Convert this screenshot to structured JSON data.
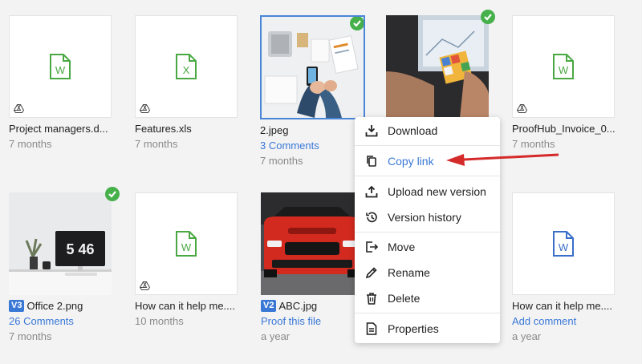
{
  "colors": {
    "word_green": "#4aa843",
    "word_blue": "#3a6fc9",
    "link_blue": "#3a78d6",
    "check_green": "#46b04a",
    "arrow_red": "#d42a2a"
  },
  "files": [
    {
      "name": "Project managers.d...",
      "line2": "7 months",
      "icon": "word-doc-icon"
    },
    {
      "name": "Features.xls",
      "line2": "7 months",
      "icon": "excel-doc-icon"
    },
    {
      "name": "2.jpeg",
      "line2": "3 Comments",
      "line3": "7 months",
      "checked": true
    },
    {
      "name": "",
      "checked": true
    },
    {
      "name": "ProofHub_Invoice_0...",
      "line2": "7 months",
      "icon": "word-doc-icon"
    },
    {
      "name": "Office 2.png",
      "version": "V3",
      "line2": "26 Comments",
      "line3": "7 months",
      "checked": true
    },
    {
      "name": "How can it help me....",
      "line2": "10 months",
      "icon": "word-doc-icon"
    },
    {
      "name": "ABC.jpg",
      "version": "V2",
      "line2": "Proof this file",
      "line3": "a year"
    },
    {
      "name": "How can it help me....",
      "line2": "Add comment",
      "line3": "a year",
      "icon": "word-doc-blue-icon"
    }
  ],
  "context_menu": {
    "items": [
      {
        "label": "Download",
        "icon": "download-icon"
      },
      {
        "label": "Copy link",
        "icon": "copy-icon",
        "active": true
      },
      {
        "label": "Upload new version",
        "icon": "upload-icon"
      },
      {
        "label": "Version history",
        "icon": "history-icon"
      },
      {
        "label": "Move",
        "icon": "move-icon"
      },
      {
        "label": "Rename",
        "icon": "pencil-icon"
      },
      {
        "label": "Delete",
        "icon": "trash-icon"
      },
      {
        "label": "Properties",
        "icon": "properties-icon"
      }
    ]
  },
  "clock_text": "5 46"
}
